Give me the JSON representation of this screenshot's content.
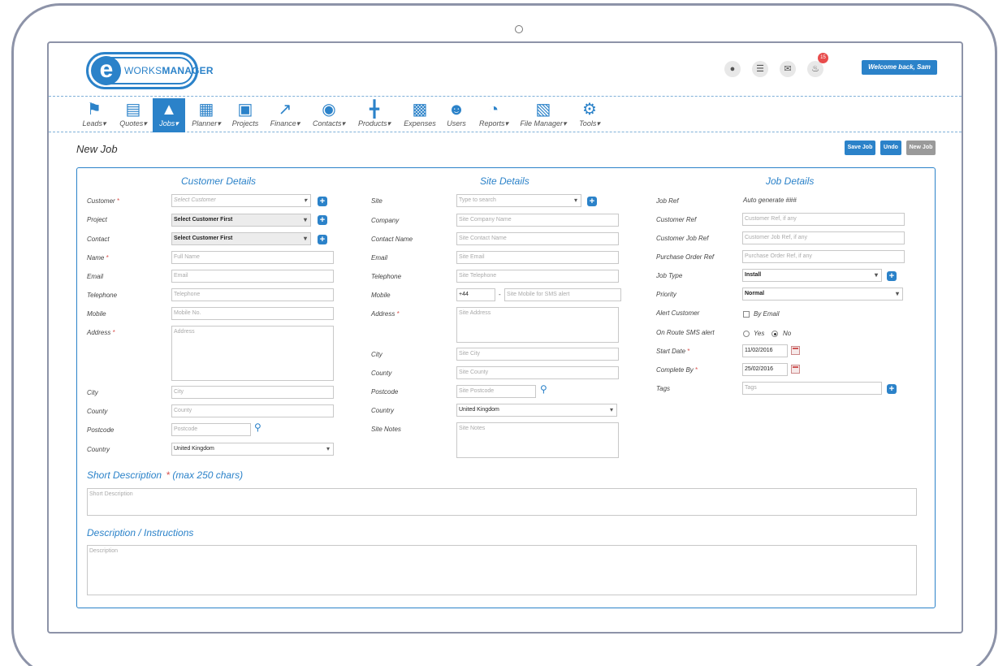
{
  "header": {
    "logo_e": "e",
    "logo_works": "WORKS",
    "logo_manager": "MANAGER",
    "notification_count": "15",
    "welcome": "Welcome back, Sam"
  },
  "nav": [
    {
      "label": "Leads▾",
      "icon": "pin-icon"
    },
    {
      "label": "Quotes▾",
      "icon": "document-icon"
    },
    {
      "label": "Jobs▾",
      "icon": "road-icon"
    },
    {
      "label": "Planner▾",
      "icon": "calendar-icon"
    },
    {
      "label": "Projects",
      "icon": "briefcase-icon"
    },
    {
      "label": "Finance▾",
      "icon": "chart-line-icon"
    },
    {
      "label": "Contacts▾",
      "icon": "chat-bubbles-icon"
    },
    {
      "label": "Products▾",
      "icon": "cart-icon"
    },
    {
      "label": "Expenses",
      "icon": "calculator-icon"
    },
    {
      "label": "Users",
      "icon": "users-icon"
    },
    {
      "label": "Reports▾",
      "icon": "pie-chart-icon"
    },
    {
      "label": "File Manager▾",
      "icon": "pdf-file-icon"
    },
    {
      "label": "Tools▾",
      "icon": "gears-icon"
    }
  ],
  "page": {
    "title": "New Job",
    "save_job": "Save Job",
    "undo": "Undo",
    "new_job": "New Job"
  },
  "customer": {
    "title": "Customer Details",
    "customer_label": "Customer",
    "customer_placeholder": "Select Customer",
    "project_label": "Project",
    "project_value": "Select Customer First",
    "contact_label": "Contact",
    "contact_value": "Select Customer First",
    "name_label": "Name",
    "name_placeholder": "Full Name",
    "email_label": "Email",
    "email_placeholder": "Email",
    "telephone_label": "Telephone",
    "telephone_placeholder": "Telephone",
    "mobile_label": "Mobile",
    "mobile_placeholder": "Mobile No.",
    "address_label": "Address",
    "address_placeholder": "Address",
    "city_label": "City",
    "city_placeholder": "City",
    "county_label": "County",
    "county_placeholder": "County",
    "postcode_label": "Postcode",
    "postcode_placeholder": "Postcode",
    "country_label": "Country",
    "country_value": "United Kingdom"
  },
  "site": {
    "title": "Site Details",
    "site_label": "Site",
    "site_placeholder": "Type to search",
    "company_label": "Company",
    "company_placeholder": "Site Company Name",
    "contact_label": "Contact Name",
    "contact_placeholder": "Site Contact Name",
    "email_label": "Email",
    "email_placeholder": "Site Email",
    "telephone_label": "Telephone",
    "telephone_placeholder": "Site Telephone",
    "mobile_label": "Mobile",
    "mobile_prefix": "+44",
    "mobile_dash": "-",
    "mobile_placeholder": "Site Mobile for SMS alert",
    "address_label": "Address",
    "address_placeholder": "Site Address",
    "city_label": "City",
    "city_placeholder": "Site City",
    "county_label": "County",
    "county_placeholder": "Site County",
    "postcode_label": "Postcode",
    "postcode_placeholder": "Site Postcode",
    "country_label": "Country",
    "country_value": "United Kingdom",
    "notes_label": "Site Notes",
    "notes_placeholder": "Site Notes"
  },
  "job": {
    "title": "Job Details",
    "ref_label": "Job Ref",
    "ref_value": "Auto generate ###",
    "customer_ref_label": "Customer Ref",
    "customer_ref_placeholder": "Customer Ref, if any",
    "customer_job_ref_label": "Customer Job Ref",
    "customer_job_ref_placeholder": "Customer Job Ref, if any",
    "po_ref_label": "Purchase Order Ref",
    "po_ref_placeholder": "Purchase Order Ref, if any",
    "type_label": "Job Type",
    "type_value": "Install",
    "priority_label": "Priority",
    "priority_value": "Normal",
    "alert_label": "Alert Customer",
    "alert_option": "By Email",
    "sms_label": "On Route SMS alert",
    "sms_yes": "Yes",
    "sms_no": "No",
    "start_label": "Start Date",
    "start_value": "11/02/2016",
    "complete_label": "Complete By",
    "complete_value": "25/02/2016",
    "tags_label": "Tags",
    "tags_placeholder": "Tags"
  },
  "short_desc": {
    "title": "Short Description",
    "req": "*",
    "hint": "(max 250 chars)",
    "placeholder": "Short Description"
  },
  "description": {
    "title": "Description / Instructions",
    "placeholder": "Description"
  },
  "colors": {
    "accent": "#2b82c9",
    "required": "#d9534f",
    "badge": "#e84c4c",
    "new_job_button": "#9a9a9a"
  }
}
